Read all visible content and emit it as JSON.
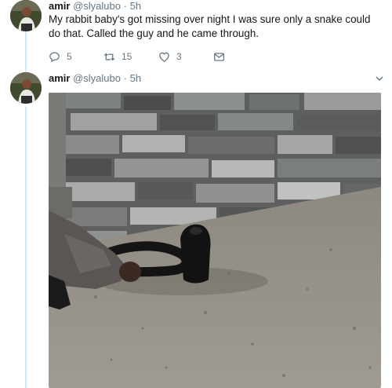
{
  "tweets": [
    {
      "name": "amir",
      "handle": "@slyalubo",
      "separator": "·",
      "time": "5h",
      "text": "My rabbit baby's got missing over night I was sure only a snake could do that. Called the guy and he came through.",
      "reply_count": "5",
      "retweet_count": "15",
      "like_count": "3"
    },
    {
      "name": "amir",
      "handle": "@slyalubo",
      "separator": "·",
      "time": "5h",
      "media": "photo of a cobra on a terrazzo floor in front of a stone wall"
    }
  ],
  "icons": {
    "reply": "reply-icon",
    "retweet": "retweet-icon",
    "like": "like-icon",
    "message": "message-icon",
    "more": "chevron-down-icon"
  },
  "colors": {
    "thread_line": "#cfe9fa",
    "secondary_text": "#657786",
    "primary_text": "#14171a"
  }
}
